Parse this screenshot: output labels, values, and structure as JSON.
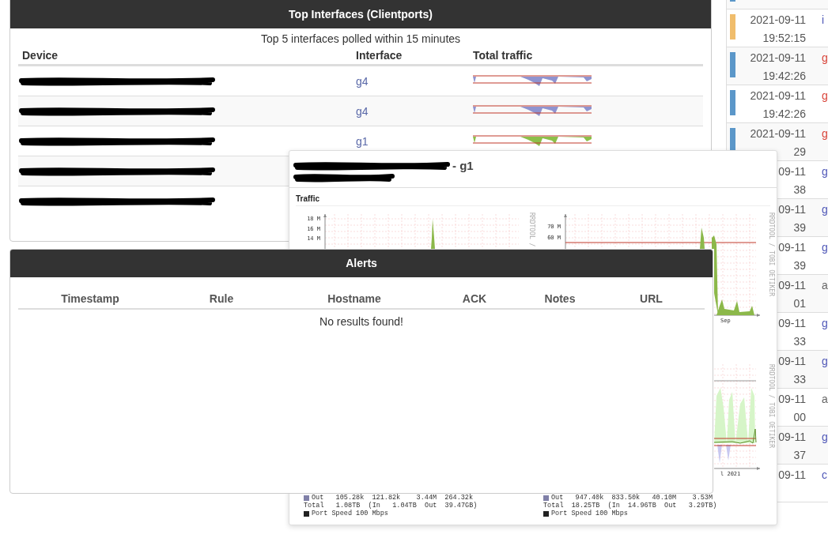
{
  "top_interfaces": {
    "title": "Top Interfaces (Clientports)",
    "caption": "Top 5 interfaces polled within 15 minutes",
    "columns": [
      "Device",
      "Interface",
      "Total traffic"
    ],
    "rows": [
      {
        "interface": "g4",
        "color": "#8f93cf"
      },
      {
        "interface": "g4",
        "color": "#8f93cf"
      },
      {
        "interface": "g1",
        "color": "#8cbf4a"
      },
      {},
      {}
    ]
  },
  "graph_popup": {
    "title": "- g1",
    "section": "Traffic",
    "graphs": [
      {
        "y_labels": [
          "18 M",
          "16 M",
          "14 M"
        ],
        "credit": "RRDTOOL /"
      },
      {
        "y_labels": [
          "70 M",
          "60 M"
        ],
        "credit": "RRDTOOL / TOBI OETIKER",
        "x_label": "Sep"
      },
      {
        "credit": "RRDTOOL / TOBI OETIKER",
        "x_label": "l 2021"
      }
    ],
    "legends": [
      {
        "lines": [
          {
            "kind": "out",
            "text": "Out   105.28k  121.82k    3.44M  264.32k"
          },
          {
            "kind": "total",
            "text": "Total   1.08TB  (In   1.04TB  Out  39.47GB)"
          },
          {
            "kind": "speed",
            "text": "Port Speed 100 Mbps"
          }
        ]
      },
      {
        "lines": [
          {
            "kind": "out",
            "text": "Out   947.40k  833.50k   40.10M    3.53M"
          },
          {
            "kind": "total",
            "text": "Total  18.25TB  (In  14.96TB  Out   3.29TB)"
          },
          {
            "kind": "speed",
            "text": "Port Speed 100 Mbps"
          }
        ]
      }
    ]
  },
  "alerts": {
    "title": "Alerts",
    "columns": [
      "Timestamp",
      "Rule",
      "Hostname",
      "ACK",
      "Notes",
      "URL"
    ],
    "empty_text": "No results found!"
  },
  "eventlog": [
    {
      "color": "#5b97c9"
    },
    {
      "color": "#f0bd6c",
      "date": "2021-09-11",
      "time": "19:52:15",
      "type": "i",
      "kind": "link"
    },
    {
      "color": "#5b97c9",
      "date": "2021-09-11",
      "time": "19:42:26",
      "type": "g",
      "kind": "alert"
    },
    {
      "color": "#5b97c9",
      "date": "2021-09-11",
      "time": "19:42:26",
      "type": "g",
      "kind": "alert"
    },
    {
      "color": "#5b97c9",
      "date": "2021-09-11",
      "time": "29",
      "type": "g",
      "kind": "alert"
    },
    {
      "date": "09-11",
      "time": "38",
      "type": "g",
      "kind": "link"
    },
    {
      "date": "09-11",
      "time": "39",
      "type": "g",
      "kind": "link"
    },
    {
      "date": "09-11",
      "time": "39",
      "type": "g",
      "kind": "link"
    },
    {
      "date": "09-11",
      "time": "01",
      "type": "a",
      "kind": "text"
    },
    {
      "date": "09-11",
      "time": "33",
      "type": "g",
      "kind": "link"
    },
    {
      "date": "09-11",
      "time": "33",
      "type": "g",
      "kind": "link"
    },
    {
      "date": "09-11",
      "time": "00",
      "type": "a",
      "kind": "text"
    },
    {
      "date": "09-11",
      "time": "37",
      "type": "g",
      "kind": "link"
    },
    {
      "date": "09-11",
      "type": "c",
      "kind": "link"
    }
  ]
}
